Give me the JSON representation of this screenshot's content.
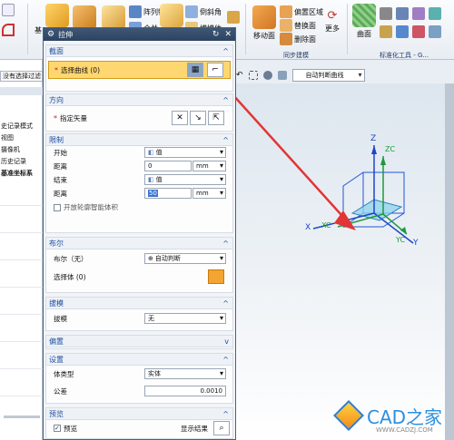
{
  "ribbon": {
    "items": {
      "pattern_feature": "阵列特征",
      "merge": "合并",
      "chamfer": "倒斜角",
      "draft_body": "拔模体",
      "move_face": "移动面",
      "offset_region": "偏置区域",
      "replace_face": "替换面",
      "delete_face": "删除面",
      "more": "更多",
      "surface": "曲面"
    },
    "groups": {
      "sync_modeling": "同步建模",
      "standard_tools": "标准化工具 - G..."
    },
    "left_clip": "基"
  },
  "toolbar2": {
    "snap_dropdown": "自动判断曲线"
  },
  "navigator": {
    "filter_text": "没有选择过滤",
    "rows": [
      "史记录模式",
      "视图",
      "摄像机",
      "历史记录",
      "基准坐标系"
    ]
  },
  "dialog": {
    "title": "拉伸",
    "section_label": "截面",
    "select_curve": "选择曲线 (0)",
    "direction_label": "方向",
    "specify_vector": "指定矢量",
    "limits_label": "限制",
    "start_label": "开始",
    "start_type": "值",
    "start_distance_label": "距离",
    "start_distance": "0",
    "start_unit": "mm",
    "end_label": "结束",
    "end_type": "值",
    "end_distance_label": "距离",
    "end_distance": "50",
    "end_unit": "mm",
    "open_profile_label": "开放轮廓智能体积",
    "boolean_section": "布尔",
    "boolean_label": "布尔（无）",
    "boolean_value": "自动判断",
    "select_body": "选择体 (0)",
    "draft_section": "拔模",
    "draft_label": "拔模",
    "draft_value": "无",
    "offset_section": "偏置",
    "settings_section": "设置",
    "body_type_label": "体类型",
    "body_type_value": "实体",
    "tolerance_label": "公差",
    "tolerance_value": "0.0010",
    "preview_section": "预览",
    "preview_label": "预览",
    "show_result": "显示结果"
  },
  "axes": {
    "x": "X",
    "y": "Y",
    "z": "Z",
    "xc": "XC",
    "yc": "YC",
    "zc": "ZC"
  },
  "watermark": {
    "brand": "CAD之家",
    "url": "WWW.CADZJ.COM"
  },
  "colors": {
    "accent": "#1f4da0",
    "highlight": "#ffd770",
    "arrow": "#e23535"
  }
}
